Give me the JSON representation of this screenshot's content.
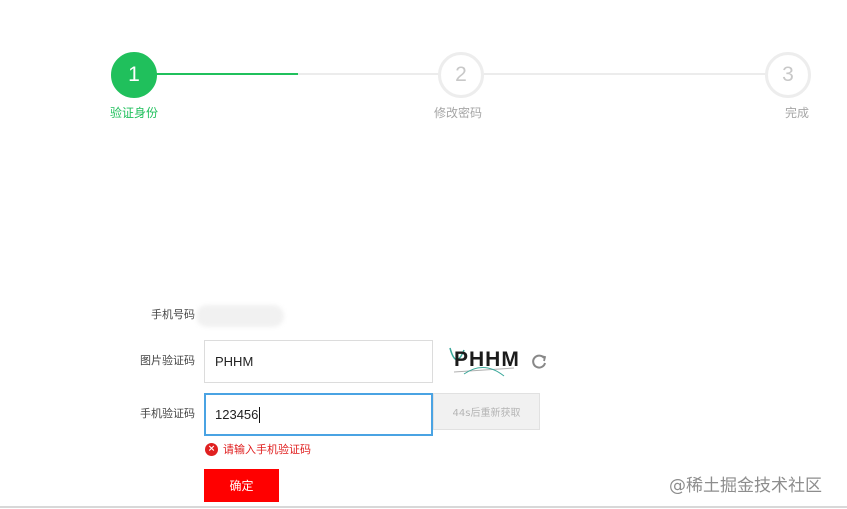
{
  "stepper": {
    "steps": [
      {
        "number": "1",
        "label": "验证身份",
        "state": "active"
      },
      {
        "number": "2",
        "label": "修改密码",
        "state": "pending"
      },
      {
        "number": "3",
        "label": "完成",
        "state": "pending"
      }
    ],
    "progress": 0.46
  },
  "form": {
    "phone": {
      "label": "手机号码"
    },
    "image_captcha": {
      "label": "图片验证码",
      "value": "PHHM",
      "captcha_text": "PHHM",
      "refresh_icon": "refresh-icon"
    },
    "sms_code": {
      "label": "手机验证码",
      "value": "123456",
      "resend_label": "44s后重新获取"
    },
    "error": {
      "icon": "error-circle-icon",
      "message": "请输入手机验证码"
    },
    "submit_label": "确定"
  },
  "watermark": "@稀土掘金技术社区",
  "colors": {
    "accent_green": "#20c05c",
    "primary_red": "#ff0000",
    "error_red": "#e02020",
    "focus_blue": "#4aa3e3"
  }
}
